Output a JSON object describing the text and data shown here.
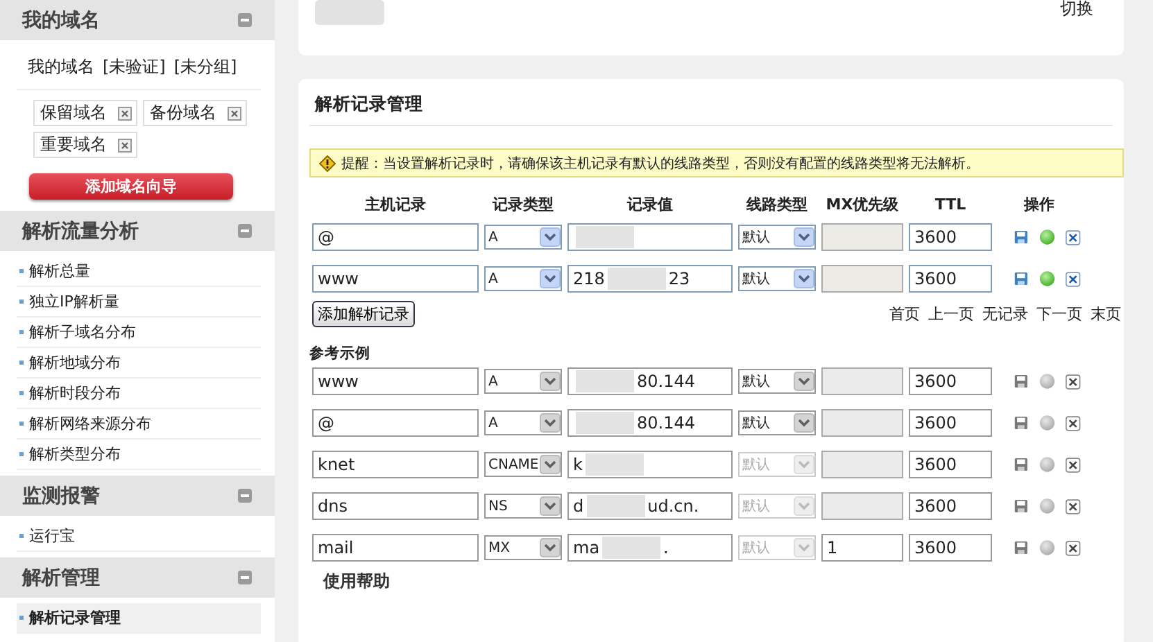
{
  "top": {
    "switch_link": "切换"
  },
  "sidebar": {
    "sections": [
      {
        "title": "我的域名",
        "kind": "domains",
        "filters": [
          "我的域名",
          "[未验证]",
          "[未分组]"
        ],
        "tags": [
          "保留域名",
          "备份域名",
          "重要域名"
        ],
        "button": "添加域名向导"
      },
      {
        "title": "解析流量分析",
        "kind": "links",
        "items": [
          {
            "label": "解析总量",
            "selected": false
          },
          {
            "label": "独立IP解析量",
            "selected": false
          },
          {
            "label": "解析子域名分布",
            "selected": false
          },
          {
            "label": "解析地域分布",
            "selected": false
          },
          {
            "label": "解析时段分布",
            "selected": false
          },
          {
            "label": "解析网络来源分布",
            "selected": false
          },
          {
            "label": "解析类型分布",
            "selected": false
          }
        ]
      },
      {
        "title": "监测报警",
        "kind": "links",
        "items": [
          {
            "label": "运行宝",
            "selected": false
          }
        ]
      },
      {
        "title": "解析管理",
        "kind": "links",
        "items": [
          {
            "label": "解析记录管理",
            "selected": true
          }
        ]
      }
    ]
  },
  "records": {
    "title": "解析记录管理",
    "notice": "提醒：当设置解析记录时，请确保该主机记录有默认的线路类型，否则没有配置的线路类型将无法解析。",
    "columns": [
      "主机记录",
      "记录类型",
      "记录值",
      "线路类型",
      "MX优先级",
      "TTL",
      "操作"
    ],
    "rows": [
      {
        "host": "@",
        "type": "A",
        "line": "默认",
        "line_enabled": true,
        "mx_enabled": false,
        "ttl": "3600",
        "active": true
      },
      {
        "host": "www",
        "type": "A",
        "value_before": "218",
        "value_after": "23",
        "line": "默认",
        "line_enabled": true,
        "mx_enabled": false,
        "ttl": "3600",
        "active": true
      }
    ],
    "add_button": "添加解析记录",
    "pager": [
      "首页",
      "上一页",
      "无记录",
      "下一页",
      "末页"
    ]
  },
  "examples": {
    "title": "参考示例",
    "rows": [
      {
        "host": "www",
        "type": "A",
        "value_after": "80.144",
        "line": "默认",
        "line_enabled": true,
        "mx_enabled": false,
        "ttl": "3600",
        "active": false
      },
      {
        "host": "@",
        "type": "A",
        "value_after": "80.144",
        "line": "默认",
        "line_enabled": true,
        "mx_enabled": false,
        "ttl": "3600",
        "active": false
      },
      {
        "host": "knet",
        "type": "CNAME",
        "value_before": "k",
        "line": "默认",
        "line_enabled": false,
        "mx_enabled": false,
        "ttl": "3600",
        "active": false
      },
      {
        "host": "dns",
        "type": "NS",
        "value_before": "d",
        "value_after": "ud.cn.",
        "line": "默认",
        "line_enabled": false,
        "mx_enabled": false,
        "ttl": "3600",
        "active": false
      },
      {
        "host": "mail",
        "type": "MX",
        "value_before": "ma",
        "value_after": ".",
        "line": "默认",
        "line_enabled": false,
        "mx_enabled": true,
        "mx": "1",
        "ttl": "3600",
        "active": false
      }
    ]
  },
  "help": {
    "title": "使用帮助"
  }
}
